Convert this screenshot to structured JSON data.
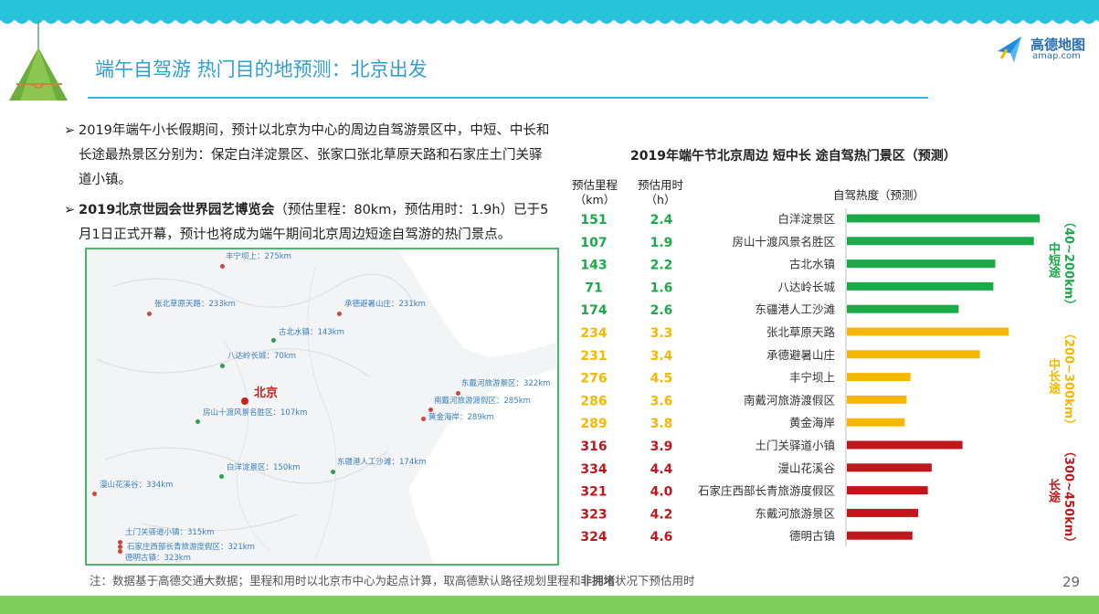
{
  "header": {
    "title": "端午自驾游 热门目的地预测：北京出发",
    "logo_cn": "高德地图",
    "logo_en": "amap.com"
  },
  "bullets": [
    {
      "marker": "➢",
      "text": "2019年端午小长假期间，预计以北京为中心的周边自驾游景区中，中短、中长和长途最热景区分别为：保定白洋淀景区、张家口张北草原天路和石家庄土门关驿道小镇。"
    },
    {
      "marker": "➢",
      "bold": "2019北京世园会世界园艺博览会",
      "text": "（预估里程：80km，预估用时：1.9h）已于5月1日正式开幕，预计也将成为端午期间北京周边短途自驾游的热门景点。"
    }
  ],
  "map": {
    "center_label": "北京",
    "pins": [
      {
        "label": "丰宁坝上：275km",
        "color": "red"
      },
      {
        "label": "张北草原天路：233km",
        "color": "red"
      },
      {
        "label": "承德避暑山庄：231km",
        "color": "red"
      },
      {
        "label": "古北水镇：143km",
        "color": "green"
      },
      {
        "label": "八达岭长城：70km",
        "color": "green"
      },
      {
        "label": "东戴河旅游景区：322km",
        "color": "red"
      },
      {
        "label": "南戴河旅游渡假区：285km",
        "color": "red"
      },
      {
        "label": "黄金海岸：289km",
        "color": "red"
      },
      {
        "label": "房山十渡风景名胜区：107km",
        "color": "green"
      },
      {
        "label": "白洋淀景区：150km",
        "color": "green"
      },
      {
        "label": "东疆港人工沙滩：174km",
        "color": "green"
      },
      {
        "label": "漫山花溪谷：334km",
        "color": "red"
      },
      {
        "label": "土门关驿道小镇：315km",
        "color": "red"
      },
      {
        "label": "石家庄西部长青旅游度假区：321km",
        "color": "red"
      },
      {
        "label": "德明古镇：323km",
        "color": "red"
      }
    ]
  },
  "chart_headers": {
    "distance": "预估里程",
    "distance_unit": "（km）",
    "time": "预估用时",
    "time_unit": "（h）",
    "heat": "自驾热度（预测）"
  },
  "groups": [
    {
      "name": "中短途",
      "range": "（40~200km）",
      "color": "#1aaa48"
    },
    {
      "name": "中长途",
      "range": "（200~300km）",
      "color": "#f5b800"
    },
    {
      "name": "长途",
      "range": "（300~450km）",
      "color": "#c0171c"
    }
  ],
  "chart_data": {
    "type": "bar",
    "orientation": "horizontal",
    "title": "2019年端午节北京周边 短中长 途自驾热门景区（预测）",
    "value_label": "自驾热度（预测）",
    "value_axis_labels": "none",
    "categories": [
      "白洋淀景区",
      "房山十渡风景名胜区",
      "古北水镇",
      "八达岭长城",
      "东疆港人工沙滩",
      "张北草原天路",
      "承德避暑山庄",
      "丰宁坝上",
      "南戴河旅游渡假区",
      "黄金海岸",
      "土门关驿道小镇",
      "漫山花溪谷",
      "石家庄西部长青旅游度假区",
      "东戴河旅游景区",
      "德明古镇"
    ],
    "values": [
      100,
      97,
      77,
      76,
      58,
      84,
      69,
      33,
      31,
      30,
      60,
      44,
      42,
      37,
      34
    ],
    "group": [
      0,
      0,
      0,
      0,
      0,
      1,
      1,
      1,
      1,
      1,
      2,
      2,
      2,
      2,
      2
    ],
    "distance_km": [
      "151",
      "107",
      "143",
      "71",
      "174",
      "234",
      "231",
      "276",
      "286",
      "289",
      "316",
      "334",
      "321",
      "323",
      "324"
    ],
    "time_h": [
      "2.4",
      "1.9",
      "2.2",
      "1.6",
      "2.6",
      "3.3",
      "3.4",
      "4.5",
      "3.6",
      "3.8",
      "3.9",
      "4.4",
      "4.0",
      "4.2",
      "4.6"
    ],
    "xlim": [
      0,
      100
    ]
  },
  "footer": {
    "note_prefix": "注：数据基于高德交通大数据；里程和用时以北京市中心为起点计算，取高德默认路径规划里程和",
    "note_bold": "非拥堵",
    "note_suffix": "状况下预估用时",
    "page_number": "29"
  }
}
